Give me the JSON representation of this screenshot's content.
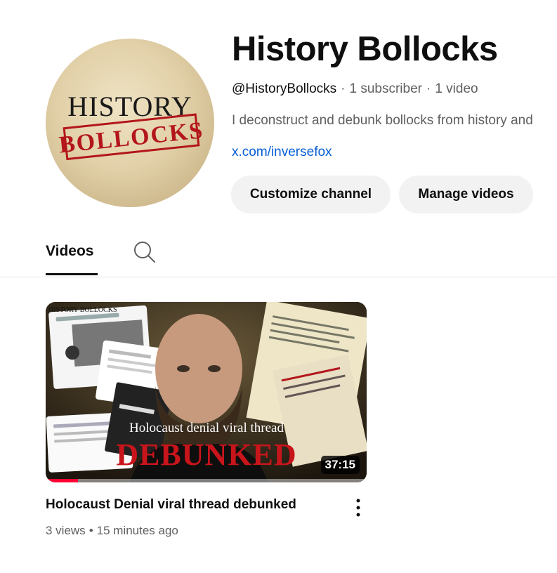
{
  "channel": {
    "name": "History Bollocks",
    "handle": "@HistoryBollocks",
    "subscribers": "1 subscriber",
    "video_count": "1 video",
    "separator": "·",
    "description": "I deconstruct and debunk bollocks from history and",
    "link": "x.com/inversefox",
    "avatar_logo": {
      "line1": "HISTORY",
      "line2": "BOLLOCKS"
    }
  },
  "buttons": {
    "customize": "Customize channel",
    "manage": "Manage videos"
  },
  "tabs": {
    "videos": "Videos",
    "search_icon": "search-icon"
  },
  "videos": [
    {
      "title": "Holocaust Denial viral thread debunked",
      "views": "3 views",
      "age": "15 minutes ago",
      "duration": "37:15",
      "watch_progress": 0.1,
      "thumbnail": {
        "logo": "HISTORY BOLLOCKS",
        "overlay_line1": "Holocaust denial viral thread",
        "overlay_line2": "DEBUNKED"
      }
    }
  ],
  "colors": {
    "link": "#065fd4",
    "button_bg": "#f2f2f2",
    "stamp_red": "#b3161b",
    "progress": "#ff0033"
  }
}
